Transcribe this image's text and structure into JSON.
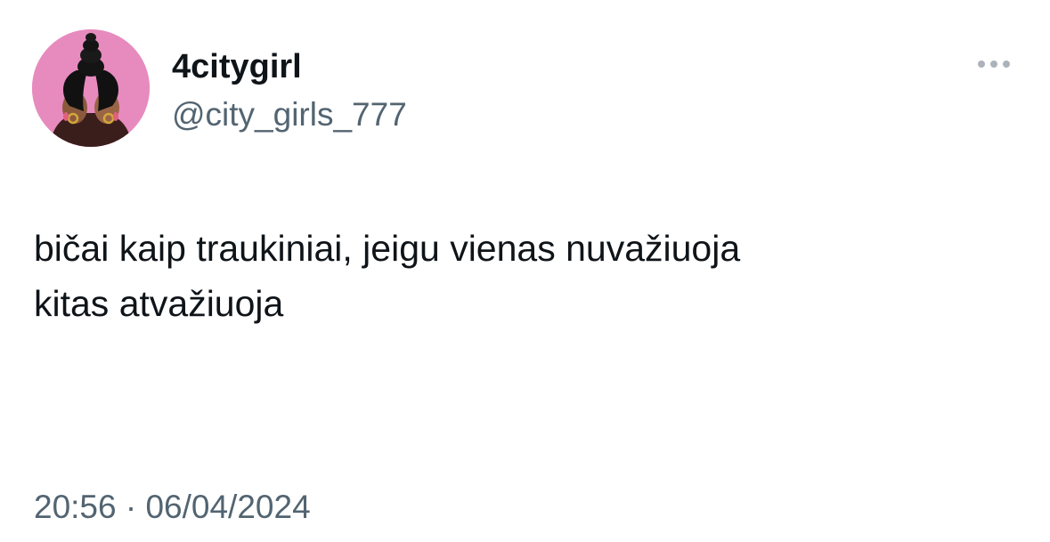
{
  "tweet": {
    "author": {
      "display_name": "4citygirl",
      "handle": "@city_girls_777"
    },
    "text_lines": [
      "bičai kaip traukiniai, jeigu vienas nuvažiuoja",
      "kitas atvažiuoja"
    ],
    "timestamp": "20:56 · 06/04/2024"
  },
  "icons": {
    "avatar": "profile-photo",
    "more": "more-options-icon"
  },
  "colors": {
    "primary_text": "#0f1419",
    "secondary_text": "#536471",
    "avatar_background": "#e78bbe",
    "more_dots": "#aab3bb"
  }
}
